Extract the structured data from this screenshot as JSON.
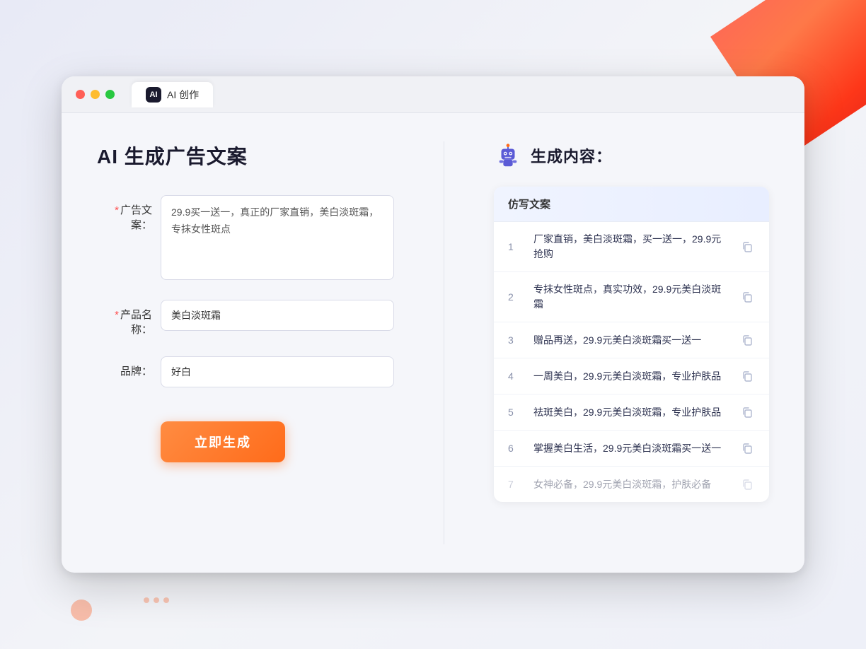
{
  "browser": {
    "tab_icon": "AI",
    "tab_title": "AI 创作"
  },
  "page": {
    "title": "AI 生成广告文案"
  },
  "form": {
    "ad_copy_label": "广告文案：",
    "ad_copy_required": "＊",
    "ad_copy_value": "29.9买一送一，真正的厂家直销，美白淡斑霜，专抹女性斑点",
    "product_name_label": "产品名称：",
    "product_name_required": "＊",
    "product_name_value": "美白淡斑霜",
    "brand_label": "品牌：",
    "brand_value": "好白",
    "generate_button": "立即生成"
  },
  "results": {
    "section_title": "生成内容：",
    "table_header": "仿写文案",
    "items": [
      {
        "num": "1",
        "text": "厂家直销，美白淡斑霜，买一送一，29.9元抢购",
        "dimmed": false
      },
      {
        "num": "2",
        "text": "专抹女性斑点，真实功效，29.9元美白淡斑霜",
        "dimmed": false
      },
      {
        "num": "3",
        "text": "赠品再送，29.9元美白淡斑霜买一送一",
        "dimmed": false
      },
      {
        "num": "4",
        "text": "一周美白，29.9元美白淡斑霜，专业护肤品",
        "dimmed": false
      },
      {
        "num": "5",
        "text": "祛斑美白，29.9元美白淡斑霜，专业护肤品",
        "dimmed": false
      },
      {
        "num": "6",
        "text": "掌握美白生活，29.9元美白淡斑霜买一送一",
        "dimmed": false
      },
      {
        "num": "7",
        "text": "女神必备，29.9元美白淡斑霜，护肤必备",
        "dimmed": true
      }
    ]
  }
}
